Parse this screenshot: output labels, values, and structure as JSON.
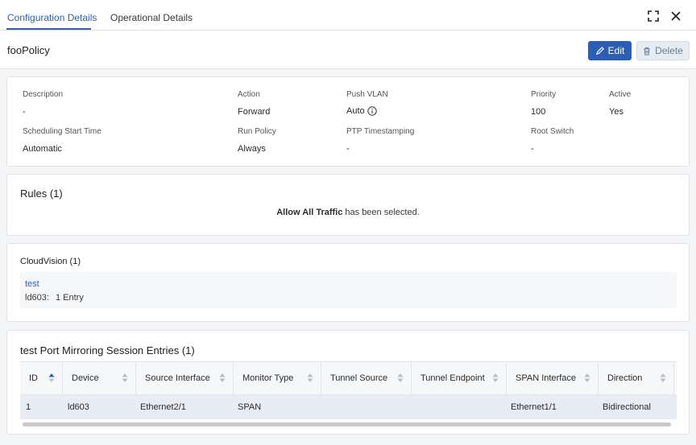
{
  "tabs": [
    {
      "label": "Configuration Details",
      "active": true
    },
    {
      "label": "Operational Details",
      "active": false
    }
  ],
  "window_icons": [
    "expand-icon",
    "close-icon"
  ],
  "title": "fooPolicy",
  "buttons": {
    "edit": "Edit",
    "delete": "Delete"
  },
  "details": {
    "description": {
      "label": "Description",
      "value": "-"
    },
    "action": {
      "label": "Action",
      "value": "Forward"
    },
    "push_vlan": {
      "label": "Push VLAN",
      "value": "Auto"
    },
    "priority": {
      "label": "Priority",
      "value": "100"
    },
    "active": {
      "label": "Active",
      "value": "Yes"
    },
    "scheduling": {
      "label": "Scheduling Start Time",
      "value": "Automatic"
    },
    "run_policy": {
      "label": "Run Policy",
      "value": "Always"
    },
    "ptp": {
      "label": "PTP Timestamping",
      "value": "-"
    },
    "root_switch": {
      "label": "Root Switch",
      "value": "-"
    }
  },
  "rules": {
    "title": "Rules (1)",
    "message_bold": "Allow All Traffic",
    "message_rest": " has been selected."
  },
  "cloudvision": {
    "title": "CloudVision (1)",
    "link": "test",
    "device": "ld603:",
    "entries": "1 Entry"
  },
  "session": {
    "title": "test Port Mirroring Session Entries (1)",
    "columns": [
      "ID",
      "Device",
      "Source Interface",
      "Monitor Type",
      "Tunnel Source",
      "Tunnel Endpoint",
      "SPAN Interface",
      "Direction"
    ],
    "sort_active_column": "ID",
    "rows": [
      [
        "1",
        "ld603",
        "Ethernet2/1",
        "SPAN",
        "",
        "",
        "Ethernet1/1",
        "Bidirectional"
      ]
    ]
  },
  "colors": {
    "accent": "#2c5fb4",
    "row_selected": "#e8ecf5"
  }
}
